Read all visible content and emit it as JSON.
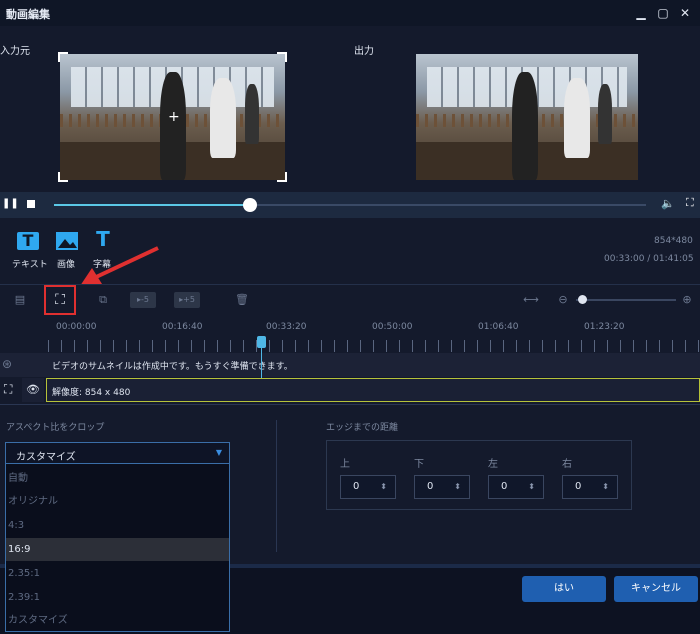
{
  "window": {
    "title": "動画編集"
  },
  "preview": {
    "input_label": "入力元",
    "output_label": "出力"
  },
  "tools": [
    {
      "icon": "text-tool-icon",
      "label": "テキスト"
    },
    {
      "icon": "image-tool-icon",
      "label": "画像"
    },
    {
      "icon": "subtitle-tool-icon",
      "label": "字幕"
    }
  ],
  "video_info": {
    "resolution": "854*480",
    "time": "00:33:00 / 01:41:05"
  },
  "timeline": {
    "toolbar_labels": {
      "minus5": "▸-5",
      "plus5": "▸+5"
    },
    "ticks": [
      "00:00:00",
      "00:16:40",
      "00:33:20",
      "00:50:00",
      "01:06:40",
      "01:23:20"
    ],
    "thumbnail_status": "ビデオのサムネイルは作成中です。もうすぐ準備できます。",
    "crop_track_label": "解像度: 854 x 480"
  },
  "crop": {
    "aspect_label": "アスペクト比をクロップ",
    "selected": "カスタマイズ",
    "options": [
      "自動",
      "オリジナル",
      "4:3",
      "16:9",
      "2.35:1",
      "2.39:1",
      "カスタマイズ"
    ],
    "highlighted_option": "16:9",
    "edge_label": "エッジまでの距離",
    "edges": [
      {
        "label": "上",
        "value": "0"
      },
      {
        "label": "下",
        "value": "0"
      },
      {
        "label": "左",
        "value": "0"
      },
      {
        "label": "右",
        "value": "0"
      }
    ]
  },
  "buttons": {
    "ok": "はい",
    "cancel": "キャンセル"
  },
  "colors": {
    "accent": "#2fa8f0",
    "primary_button": "#1f5fb0",
    "highlight_box": "#e03030"
  }
}
